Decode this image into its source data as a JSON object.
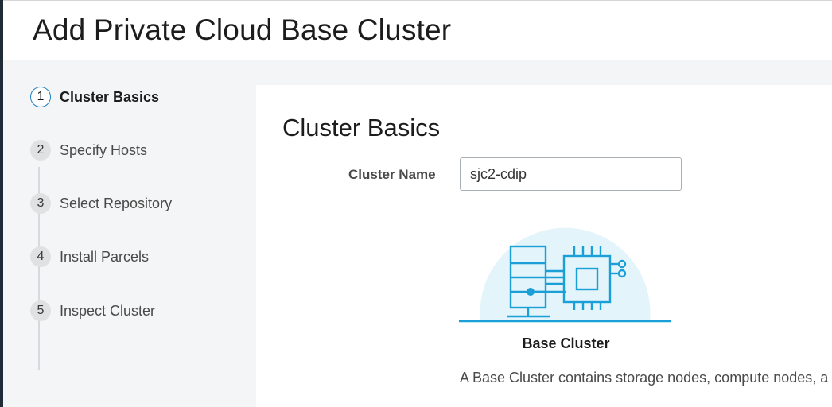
{
  "header": {
    "title": "Add Private Cloud Base Cluster"
  },
  "steps": [
    {
      "number": "1",
      "label": "Cluster Basics"
    },
    {
      "number": "2",
      "label": "Specify Hosts"
    },
    {
      "number": "3",
      "label": "Select Repository"
    },
    {
      "number": "4",
      "label": "Install Parcels"
    },
    {
      "number": "5",
      "label": "Inspect Cluster"
    }
  ],
  "active_step": 1,
  "main": {
    "section_title": "Cluster Basics",
    "cluster_name_label": "Cluster Name",
    "cluster_name_value": "sjc2-cdip",
    "card": {
      "icon": "base-cluster-icon",
      "title": "Base Cluster",
      "description": "A Base Cluster contains storage nodes, compute nodes, a"
    }
  },
  "colors": {
    "accent": "#1c7fc4",
    "illustration_line": "#1aa0d6",
    "illustration_circle": "#e3f4fb",
    "sidebar_bg": "#f4f5f6"
  }
}
